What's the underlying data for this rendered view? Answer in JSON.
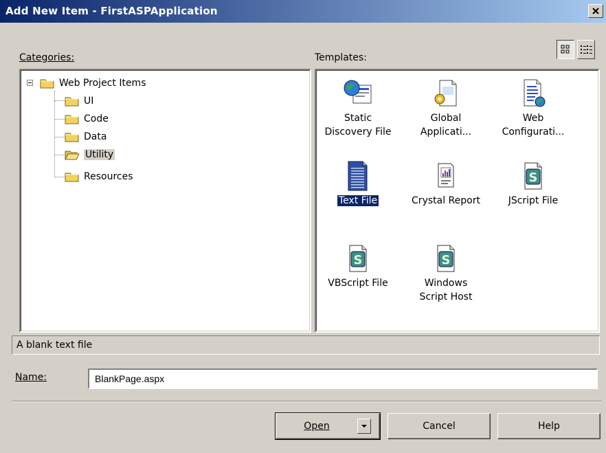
{
  "window": {
    "title": "Add New Item - FirstASPApplication"
  },
  "categories": {
    "label": "Categories:",
    "tree": [
      {
        "label": "Web Project Items",
        "expanded": true
      },
      {
        "label": "UI"
      },
      {
        "label": "Code"
      },
      {
        "label": "Data"
      },
      {
        "label": "Utility",
        "selected": true
      },
      {
        "label": "Resources"
      }
    ]
  },
  "templates": {
    "label": "Templates:",
    "view_large_icons": "large-icons",
    "view_small_icons": "small-icons",
    "items": [
      {
        "line1": "Static",
        "line2": "Discovery File",
        "icon": "static-discovery-icon"
      },
      {
        "line1": "Global",
        "line2": "Applicati...",
        "icon": "global-application-icon"
      },
      {
        "line1": "Web",
        "line2": "Configurati...",
        "icon": "web-config-icon"
      },
      {
        "line1": "Text File",
        "line2": "",
        "icon": "text-file-icon",
        "selected": true
      },
      {
        "line1": "Crystal Report",
        "line2": "",
        "icon": "crystal-report-icon"
      },
      {
        "line1": "JScript File",
        "line2": "",
        "icon": "script-file-icon"
      },
      {
        "line1": "VBScript File",
        "line2": "",
        "icon": "script-file-icon"
      },
      {
        "line1": "Windows",
        "line2": "Script Host",
        "icon": "script-file-icon"
      }
    ]
  },
  "description": "A blank text file",
  "name": {
    "label": "Name:",
    "value": "BlankPage.aspx"
  },
  "buttons": {
    "open": "Open",
    "cancel": "Cancel",
    "help": "Help"
  },
  "colors": {
    "titlebar_start": "#0a246a",
    "titlebar_end": "#a6caf0",
    "dialog_bg": "#d4d0c8",
    "selection": "#0a246a"
  }
}
